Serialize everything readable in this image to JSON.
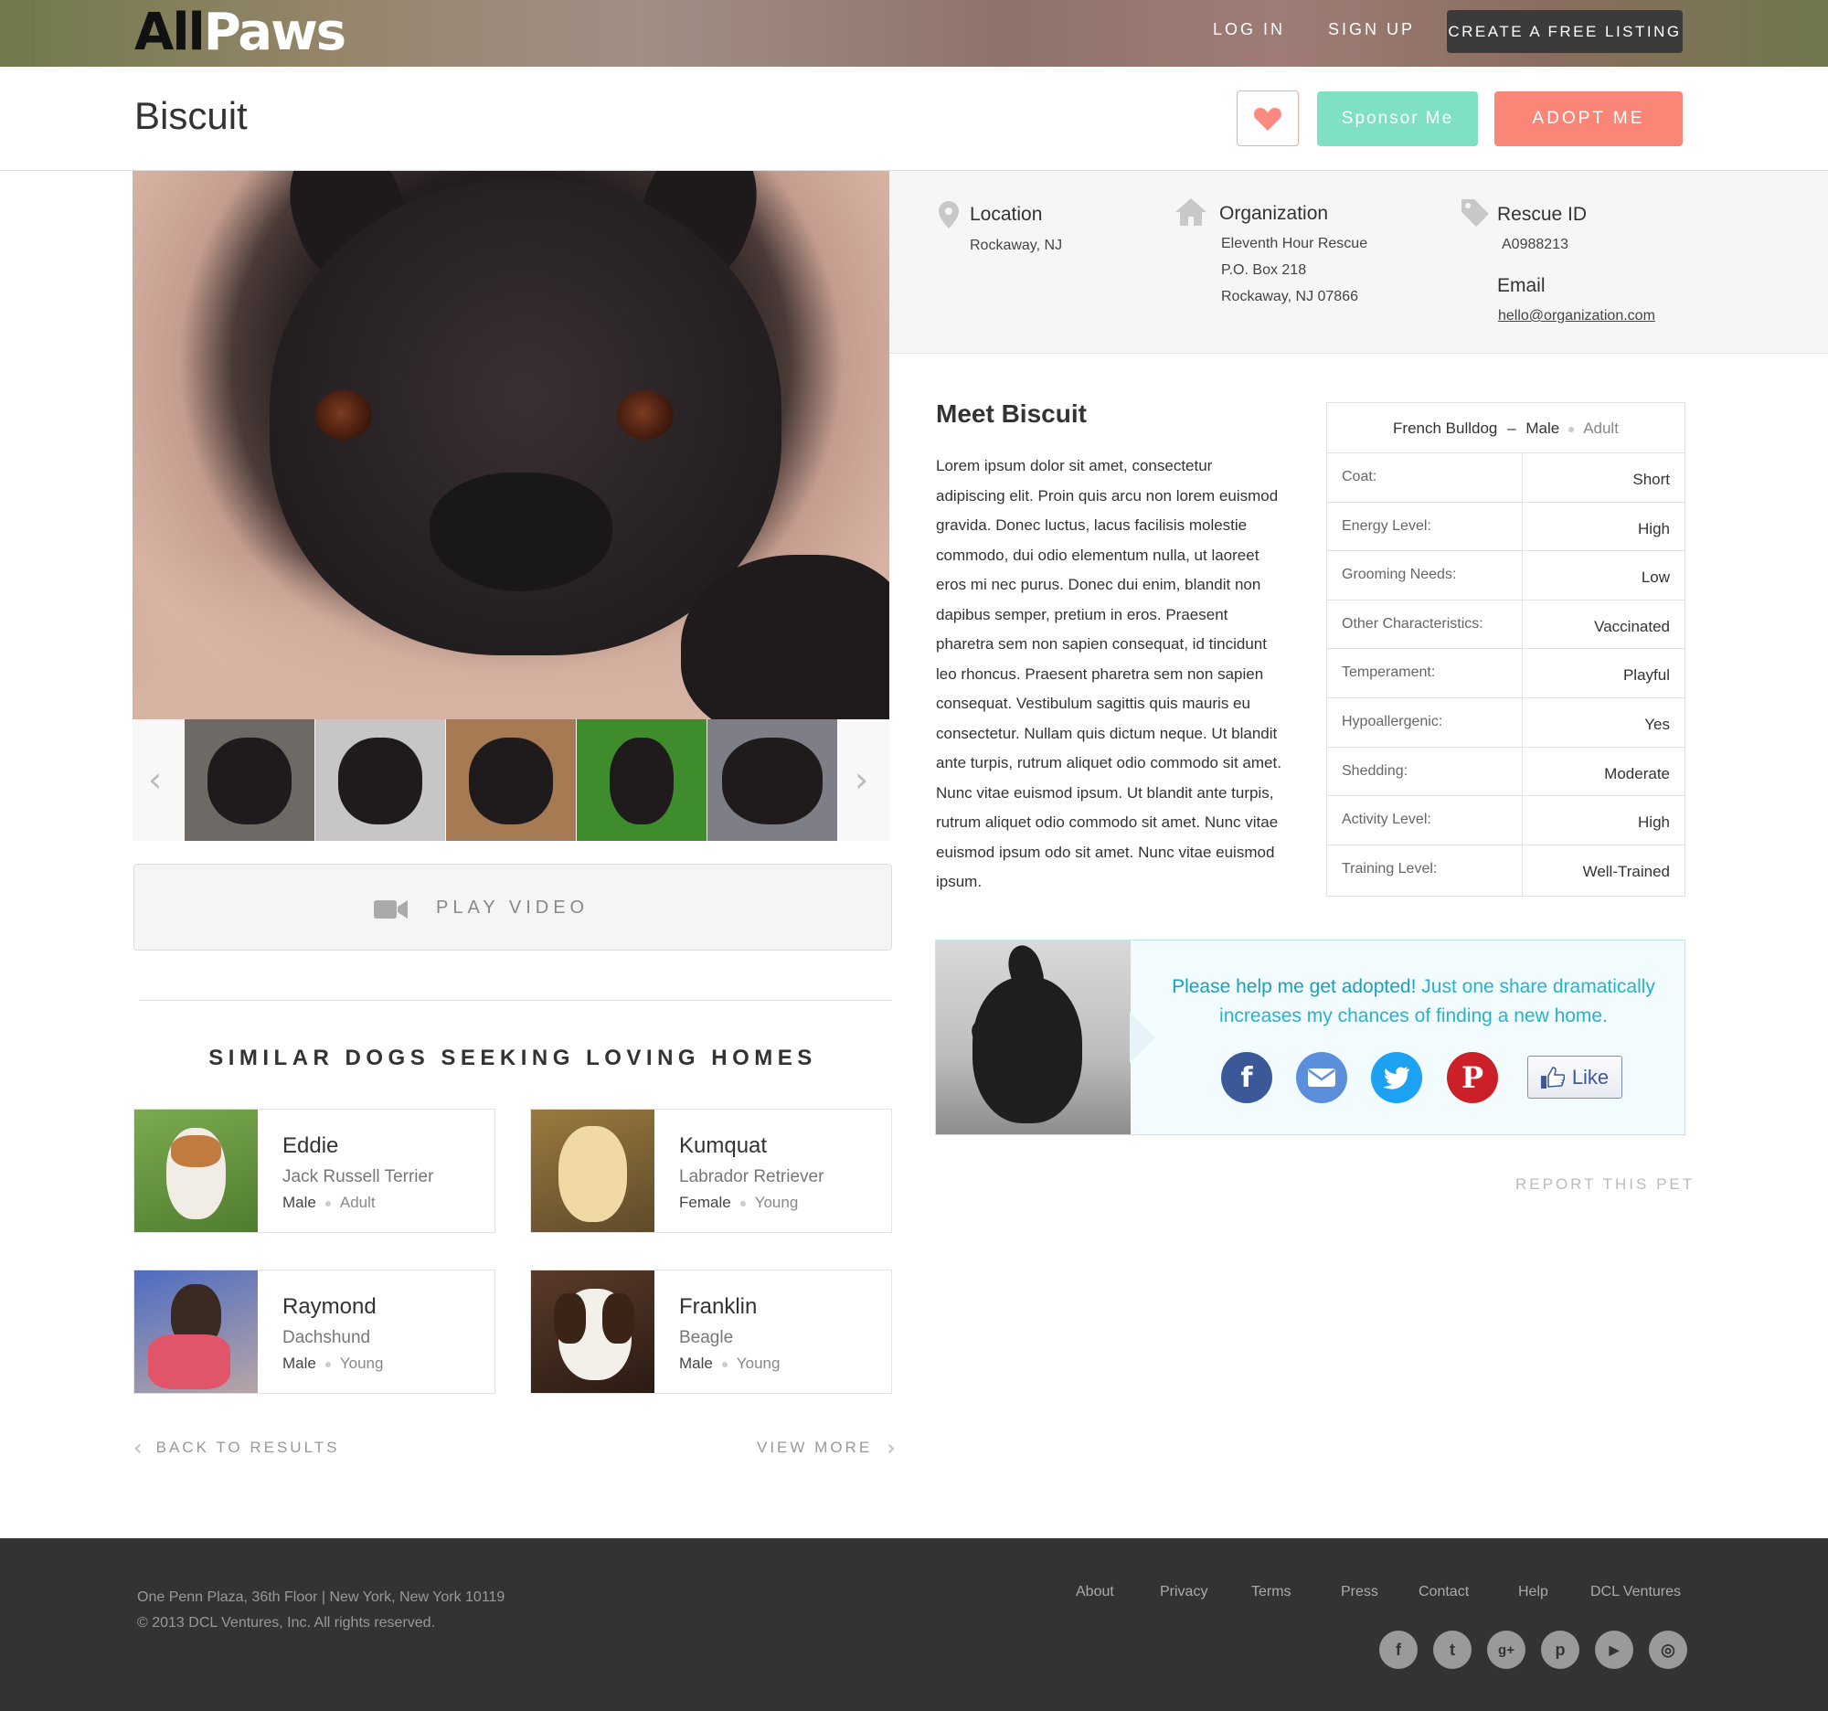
{
  "header": {
    "logo_all": "All",
    "logo_paws": "Paws",
    "login": "LOG IN",
    "signup": "SIGN UP",
    "create_listing": "CREATE A FREE LISTING"
  },
  "pet": {
    "name": "Biscuit",
    "sponsor": "Sponsor Me",
    "adopt": "ADOPT ME"
  },
  "info": {
    "location_label": "Location",
    "location_value": "Rockaway, NJ",
    "organization_label": "Organization",
    "organization_lines": [
      "Eleventh Hour Rescue",
      "P.O. Box 218",
      "Rockaway, NJ 07866"
    ],
    "rescue_id_label": "Rescue ID",
    "rescue_id_value": "A0988213",
    "email_label": "Email",
    "email_value": "hello@organization.com"
  },
  "meet": {
    "title": "Meet Biscuit",
    "description": "Lorem ipsum dolor sit amet, consectetur adipiscing elit. Proin quis arcu non lorem euismod gravida. Donec luctus, lacus facilisis molestie commodo, dui odio elementum nulla, ut laoreet eros mi nec purus. Donec dui enim, blandit non dapibus semper, pretium in eros. Praesent pharetra sem non sapien consequat, id tincidunt leo rhoncus. Praesent pharetra sem non sapien consequat. Vestibulum sagittis quis mauris eu consectetur. Nullam quis dictum neque. Ut blandit ante turpis, rutrum aliquet odio commodo sit amet. Nunc vitae euismod ipsum. Ut blandit ante turpis, rutrum aliquet odio commodo sit amet. Nunc vitae euismod ipsum odo sit amet. Nunc vitae euismod ipsum."
  },
  "attributes": {
    "breed": "French Bulldog",
    "separator": "–",
    "sex": "Male",
    "age": "Adult",
    "rows": [
      {
        "key": "Coat:",
        "value": "Short"
      },
      {
        "key": "Energy Level:",
        "value": "High"
      },
      {
        "key": "Grooming Needs:",
        "value": "Low"
      },
      {
        "key": "Other Characteristics:",
        "value": "Vaccinated"
      },
      {
        "key": "Temperament:",
        "value": "Playful"
      },
      {
        "key": "Hypoallergenic:",
        "value": "Yes"
      },
      {
        "key": "Shedding:",
        "value": "Moderate"
      },
      {
        "key": "Activity Level:",
        "value": "High"
      },
      {
        "key": "Training Level:",
        "value": "Well-Trained"
      }
    ]
  },
  "gallery": {
    "prev_icon": "chevron-left-icon",
    "next_icon": "chevron-right-icon",
    "thumb_colors": [
      "#6d6a66",
      "#c8c6c4",
      "#a67a52",
      "#3f8c2d",
      "#7e7e86"
    ]
  },
  "video": {
    "label": "PLAY VIDEO",
    "icon": "video-camera-icon"
  },
  "share": {
    "message_strong": "Please help me get adopted!",
    "message_rest": " Just one share dramatically increases my chances of finding a new home.",
    "like_label": "Like",
    "colors": {
      "facebook": "#3b5998",
      "email": "#5b8fdc",
      "twitter": "#1da1f2",
      "pinterest": "#cb2027"
    }
  },
  "report": "REPORT THIS PET",
  "similar": {
    "title": "SIMILAR DOGS SEEKING LOVING HOMES",
    "dogs": [
      {
        "name": "Eddie",
        "breed": "Jack Russell Terrier",
        "sex": "Male",
        "age": "Adult",
        "bg": "#5a8a3a"
      },
      {
        "name": "Kumquat",
        "breed": "Labrador Retriever",
        "sex": "Female",
        "age": "Young",
        "bg": "#8a6a3a"
      },
      {
        "name": "Raymond",
        "breed": "Dachshund",
        "sex": "Male",
        "age": "Young",
        "bg": "#6a7ab8"
      },
      {
        "name": "Franklin",
        "breed": "Beagle",
        "sex": "Male",
        "age": "Young",
        "bg": "#4a3326"
      }
    ],
    "back": "BACK TO RESULTS",
    "more": "VIEW MORE"
  },
  "footer": {
    "address": "One Penn Plaza, 36th Floor | New York, New York 10119",
    "copyright": "© 2013 DCL Ventures, Inc. All rights reserved.",
    "links": [
      "About",
      "Privacy",
      "Terms",
      "Press",
      "Contact",
      "Help",
      "DCL Ventures"
    ],
    "social": [
      {
        "icon": "facebook-icon",
        "glyph": "f"
      },
      {
        "icon": "twitter-icon",
        "glyph": "t"
      },
      {
        "icon": "google-plus-icon",
        "glyph": "g+"
      },
      {
        "icon": "pinterest-icon",
        "glyph": "p"
      },
      {
        "icon": "youtube-icon",
        "glyph": "▶"
      },
      {
        "icon": "instagram-icon",
        "glyph": "◎"
      }
    ]
  }
}
